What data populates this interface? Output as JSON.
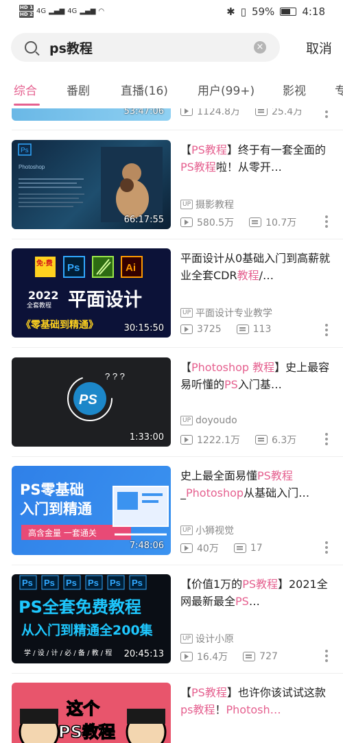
{
  "status_bar": {
    "signal_1": "4G",
    "signal_2": "4G",
    "battery": "59%",
    "time": "4:18"
  },
  "search": {
    "query": "ps教程",
    "cancel_label": "取消"
  },
  "tabs": [
    {
      "label": "综合",
      "active": true
    },
    {
      "label": "番剧",
      "active": false
    },
    {
      "label": "直播(16)",
      "active": false
    },
    {
      "label": "用户(99+)",
      "active": false
    },
    {
      "label": "影视",
      "active": false
    },
    {
      "label": "专",
      "active": false
    }
  ],
  "videos": [
    {
      "duration": "53:47:06",
      "title_parts": [],
      "author": "",
      "views": "1124.8万",
      "comments": "25.4万"
    },
    {
      "duration": "66:17:55",
      "title_parts": [
        [
          "【",
          false
        ],
        [
          "PS教程",
          true
        ],
        [
          "】终于有一套全面的",
          false
        ],
        [
          "PS教程",
          true
        ],
        [
          "啦！从零开…",
          false
        ]
      ],
      "author": "摄影教程",
      "views": "580.5万",
      "comments": "10.7万"
    },
    {
      "duration": "30:15:50",
      "title_parts": [
        [
          "平面设计从0基础入门到高薪就业全套CDR",
          false
        ],
        [
          "教程",
          true
        ],
        [
          "/…",
          false
        ]
      ],
      "author": "平面设计专业教学",
      "views": "3725",
      "comments": "113"
    },
    {
      "duration": "1:33:00",
      "title_parts": [
        [
          "【",
          false
        ],
        [
          "Photoshop 教程",
          true
        ],
        [
          "】史上最容易听懂的",
          false
        ],
        [
          "PS",
          true
        ],
        [
          "入门基…",
          false
        ]
      ],
      "author": "doyoudo",
      "views": "1222.1万",
      "comments": "6.3万"
    },
    {
      "duration": "7:48:06",
      "title_parts": [
        [
          "史上最全面易懂",
          false
        ],
        [
          "PS教程",
          true
        ],
        [
          "_",
          false
        ],
        [
          "Photoshop",
          true
        ],
        [
          "从基础入门…",
          false
        ]
      ],
      "author": "小狮视觉",
      "views": "40万",
      "comments": "17"
    },
    {
      "duration": "20:45:13",
      "title_parts": [
        [
          "【价值1万的",
          false
        ],
        [
          "PS教程",
          true
        ],
        [
          "】2021全网最新最全",
          false
        ],
        [
          "PS",
          true
        ],
        [
          "…",
          false
        ]
      ],
      "author": "设计小原",
      "views": "16.4万",
      "comments": "727"
    },
    {
      "duration": "",
      "title_parts": [
        [
          "【",
          false
        ],
        [
          "PS教程",
          true
        ],
        [
          "】也许你该试试这款",
          false
        ],
        [
          "ps教程",
          true
        ],
        [
          "！",
          false
        ],
        [
          "Photosh…",
          true
        ]
      ],
      "author": "",
      "views": "",
      "comments": ""
    }
  ],
  "thumb_texts": {
    "t1_brand": "Photoshop",
    "t2_badge": "免·费",
    "t2_ps": "Ps",
    "t2_ai": "Ai",
    "t2_year": "2022",
    "t2_sub": "全套教程",
    "t2_big": "平面设计",
    "t2_bottom": "《零基础到精通》",
    "t4_line1": "PS零基础",
    "t4_line2": "入门到精通",
    "t4_tag": "高含金量 一套通关",
    "t5_ps": "Ps",
    "t5_line1": "PS全套免费教程",
    "t5_line2": "从入门到精通全200集",
    "t5_line3": "学 / 设 / 计 / 必 / 备 / 教 / 程",
    "t6_line1": "这个",
    "t6_line2": "PS教程"
  },
  "colors": {
    "accent": "#e5608f"
  }
}
